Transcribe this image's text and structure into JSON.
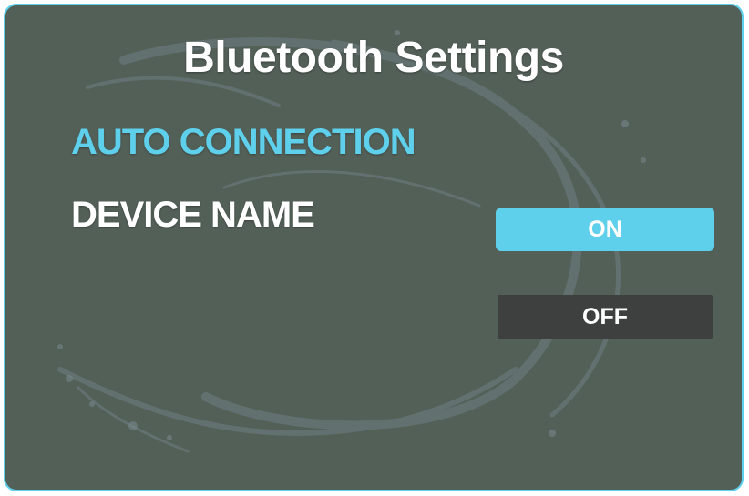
{
  "screen": {
    "title": "Bluetooth Settings"
  },
  "menu": {
    "items": [
      {
        "label": "AUTO CONNECTION",
        "selected": true
      },
      {
        "label": "DEVICE NAME",
        "selected": false
      }
    ]
  },
  "options": {
    "on_label": "ON",
    "off_label": "OFF",
    "selected": "ON"
  },
  "colors": {
    "accent": "#5fd0ec",
    "background": "#536058",
    "off_button": "#3e403f",
    "text": "#ffffff"
  }
}
